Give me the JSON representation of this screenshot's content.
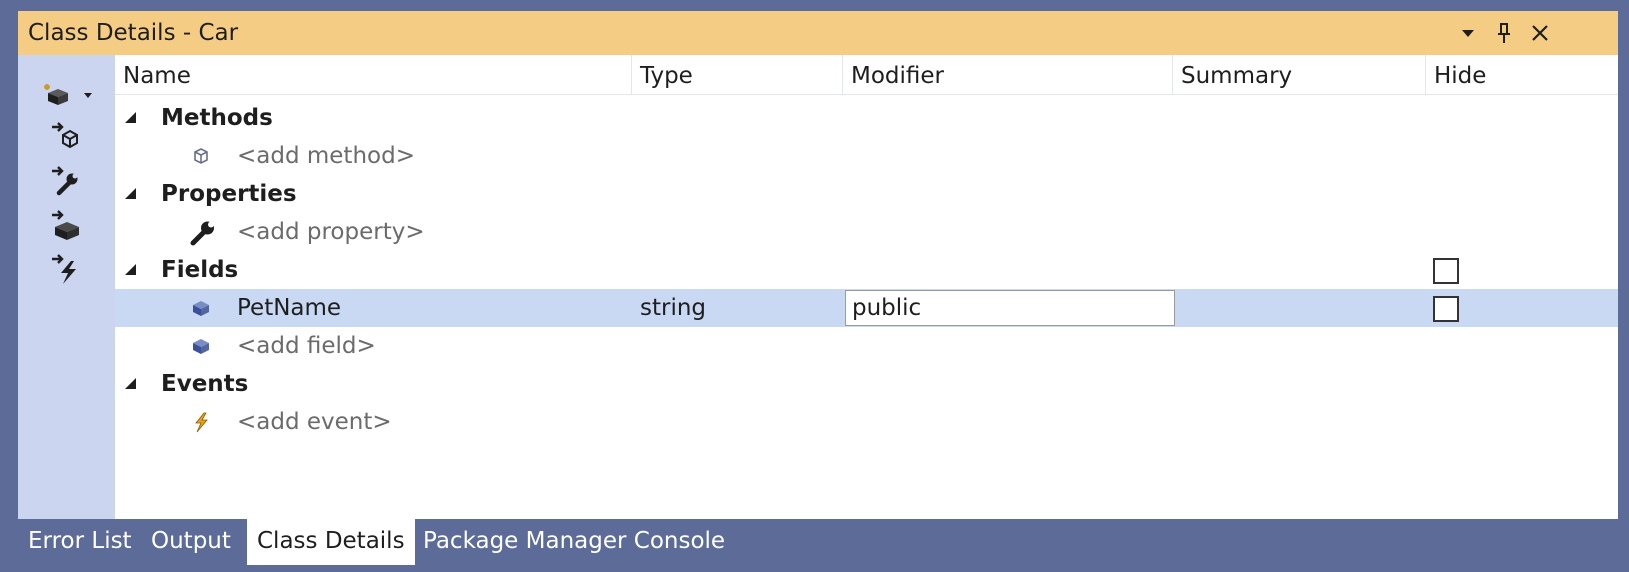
{
  "window": {
    "title": "Class Details - Car",
    "controls": [
      "dropdown-icon",
      "pin-icon",
      "close-icon"
    ]
  },
  "toolbar": {
    "tools": [
      "new-member-icon",
      "new-method-icon",
      "new-property-icon",
      "new-field-icon",
      "new-event-icon"
    ]
  },
  "columns": [
    "Name",
    "Type",
    "Modifier",
    "Summary",
    "Hide"
  ],
  "groups": {
    "methods": {
      "label": "Methods",
      "add_label": "<add method>"
    },
    "properties": {
      "label": "Properties",
      "add_label": "<add property>"
    },
    "fields": {
      "label": "Fields",
      "add_label": "<add field>",
      "items": [
        {
          "name": "PetName",
          "type": "string",
          "modifier": "public",
          "summary": "",
          "hide": false
        }
      ]
    },
    "events": {
      "label": "Events",
      "add_label": "<add event>"
    }
  },
  "tabs": [
    "Error List",
    "Output",
    "Class Details",
    "Package Manager Console"
  ],
  "active_tab": "Class Details",
  "colors": {
    "title_bar": "#f5cc84",
    "frame": "#5d6b99",
    "toolbar": "#ccd5f0",
    "selected_row": "#c9d8f3"
  }
}
